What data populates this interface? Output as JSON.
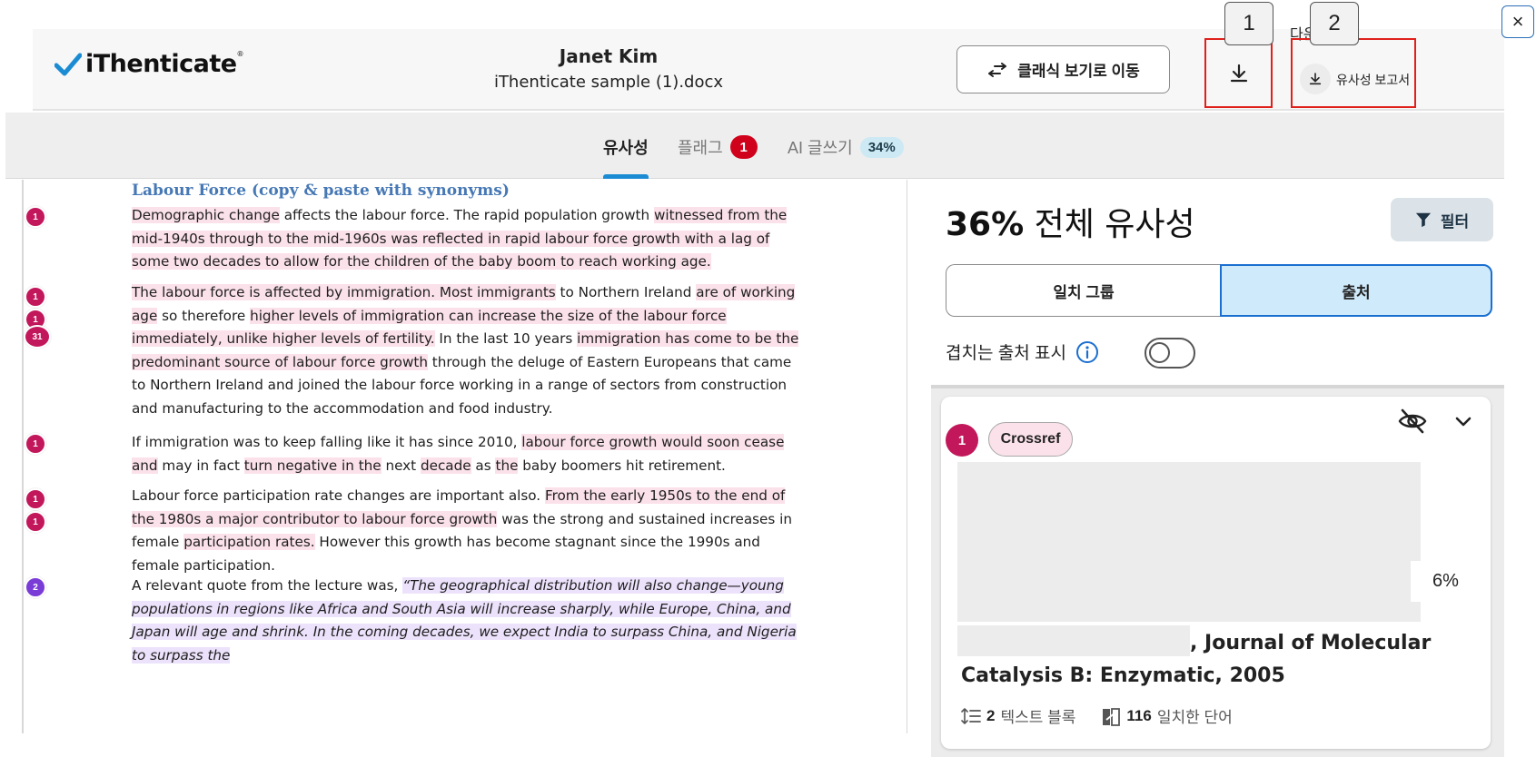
{
  "header": {
    "logo_text": "iThenticate",
    "logo_mark": "®",
    "user_name": "Janet Kim",
    "file_name": "iThenticate sample (1).docx",
    "classic_view_label": "클래식 보기로 이동",
    "download_report_label": "유사성 보고서",
    "partially_hidden_text": "다운",
    "close_symbol": "×"
  },
  "callouts": [
    "1",
    "2"
  ],
  "tabs": {
    "similarity": "유사성",
    "flags": "플래그",
    "flags_count": "1",
    "ai_writing": "AI 글쓰기",
    "ai_percent": "34%"
  },
  "document": {
    "heading": "Labour Force (copy & paste with synonyms)",
    "p1": [
      {
        "t": "Demographic change",
        "h": "pink"
      },
      {
        "t": " affects the labour force.  The rapid population growth "
      },
      {
        "t": "witnessed from the mid-1940s through to the mid-1960s was reflected in rapid labour force growth with a lag of some two decades to allow for the children of the baby boom to reach working age.",
        "h": "pink"
      }
    ],
    "p2": [
      {
        "t": "The labour force is affected by immigration. Most immigrants",
        "h": "pink"
      },
      {
        "t": " to Northern Ireland "
      },
      {
        "t": "are of working age",
        "h": "pink"
      },
      {
        "t": " so therefore "
      },
      {
        "t": "higher levels of immigration can increase the size of the labour force immediately, unlike higher levels of fertility.",
        "h": "pink"
      },
      {
        "t": " In the last 10 years "
      },
      {
        "t": "immigration has come to be the predominant source of labour force growth",
        "h": "pink"
      },
      {
        "t": " through the deluge of Eastern Europeans that came to Northern Ireland and joined the labour force working in a range of sectors from construction and manufacturing to the accommodation and food industry."
      }
    ],
    "p3": [
      {
        "t": "If immigration was to keep falling like it has since 2010, "
      },
      {
        "t": "labour force growth would soon cease and",
        "h": "pink"
      },
      {
        "t": " may in fact "
      },
      {
        "t": "turn negative in the",
        "h": "pink"
      },
      {
        "t": " next "
      },
      {
        "t": "decade",
        "h": "pink"
      },
      {
        "t": " as "
      },
      {
        "t": "the",
        "h": "pink"
      },
      {
        "t": " baby boomers hit retirement."
      }
    ],
    "p4": [
      {
        "t": "Labour force participation rate changes are important also. "
      },
      {
        "t": "From the early 1950s to the end of the 1980s a major contributor to labour force growth",
        "h": "pink"
      },
      {
        "t": " was the strong and sustained increases in female "
      },
      {
        "t": "participation rates.",
        "h": "pink"
      },
      {
        "t": " However this growth has become stagnant since the 1990s and female participation."
      }
    ],
    "p5": [
      {
        "t": "A relevant quote from the lecture was, "
      },
      {
        "t": "“The geographical distribution will also change—young populations in regions like Africa and South Asia will increase sharply, while Europe, China, and Japan will age and shrink. In the coming decades, we expect India to surpass China, and Nigeria to surpass the",
        "h": "purple"
      }
    ],
    "markers": [
      "1",
      "1",
      "1",
      "31",
      "1",
      "1",
      "1",
      "2"
    ]
  },
  "panel": {
    "similarity_percent": "36%",
    "similarity_title": "전체 유사성",
    "filter_label": "필터",
    "seg_match_groups": "일치 그룹",
    "seg_sources": "출처",
    "overlap_label": "겹치는 출처 표시",
    "overlap_enabled": false
  },
  "source": {
    "rank": "1",
    "tag": "Crossref",
    "percent": "6%",
    "title_line1": ", Journal of Molecular",
    "title_line2": "Catalysis B: Enzymatic, 2005",
    "text_blocks_count": "2",
    "text_blocks_label": "텍스트 블록",
    "matched_words_count": "116",
    "matched_words_label": "일치한 단어"
  },
  "colors": {
    "accent_blue": "#1b8cd4",
    "highlight_pink": "#fbe1ea",
    "highlight_purple": "#ece2fb",
    "marker_pink": "#c2185b",
    "marker_purple": "#7a3cd6",
    "flag_red": "#d0021b",
    "callout_red": "#e0201b"
  }
}
